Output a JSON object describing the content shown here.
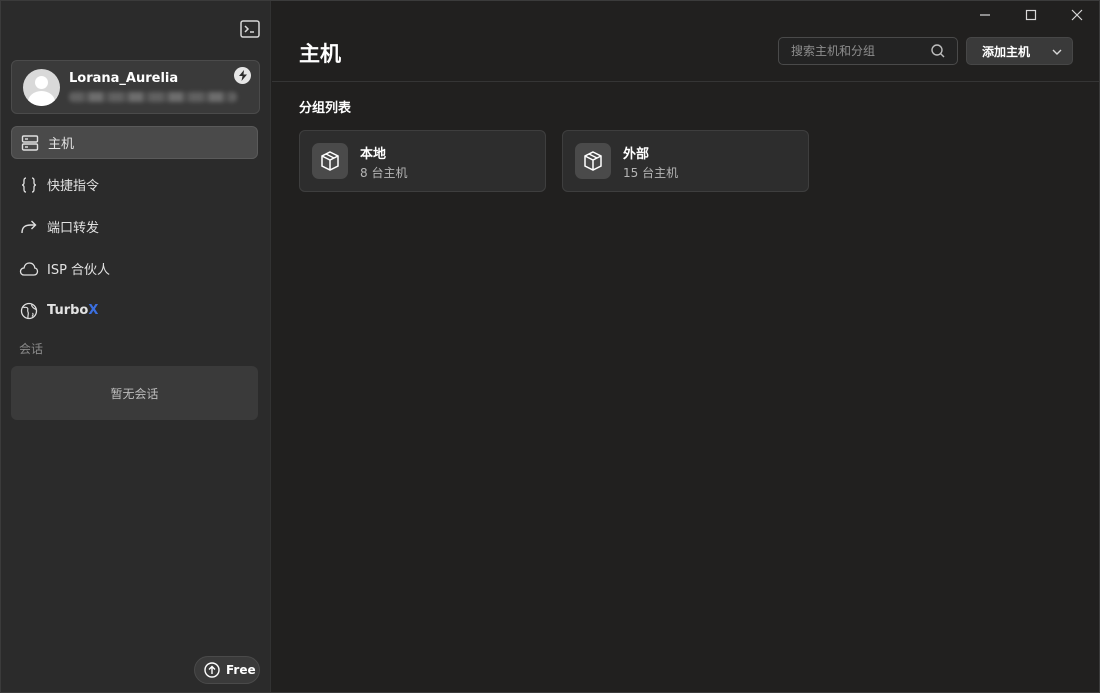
{
  "sidebar": {
    "user": {
      "name": "Lorana_Aurelia"
    },
    "nav": [
      {
        "label": "主机",
        "icon": "server-icon"
      },
      {
        "label": "快捷指令",
        "icon": "braces-icon"
      },
      {
        "label": "端口转发",
        "icon": "forward-arrow-icon"
      },
      {
        "label": "ISP 合伙人",
        "icon": "cloud-icon"
      },
      {
        "label_main": "Turbo",
        "label_accent": "X",
        "icon": "globe-icon"
      }
    ],
    "sessions_title": "会话",
    "sessions_empty": "暂无会话",
    "plan_label": "Free"
  },
  "main": {
    "title": "主机",
    "search_placeholder": "搜索主机和分组",
    "add_label": "添加主机",
    "group_title": "分组列表",
    "groups": [
      {
        "name": "本地",
        "count": "8 台主机"
      },
      {
        "name": "外部",
        "count": "15 台主机"
      }
    ]
  },
  "colors": {
    "accent": "#3b6fe0",
    "sidebar_bg": "#2b2b2b",
    "main_bg": "#21201f"
  }
}
